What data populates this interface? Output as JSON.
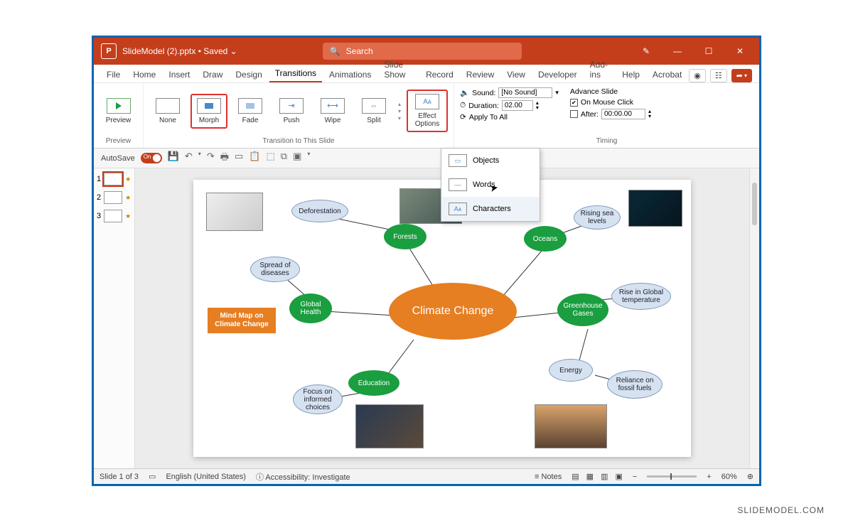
{
  "titlebar": {
    "appLetter": "P",
    "filename": "SlideModel (2).pptx",
    "savedState": "Saved",
    "searchPlaceholder": "Search"
  },
  "winControls": {
    "minimize": "—",
    "maximize": "☐",
    "close": "✕",
    "mic": "✎"
  },
  "tabs": [
    "File",
    "Home",
    "Insert",
    "Draw",
    "Design",
    "Transitions",
    "Animations",
    "Slide Show",
    "Record",
    "Review",
    "View",
    "Developer",
    "Add-ins",
    "Help",
    "Acrobat"
  ],
  "activeTab": "Transitions",
  "rightControls": {
    "record": "◉",
    "cc": "☷",
    "share": "➦"
  },
  "ribbon": {
    "previewGroupLabel": "Preview",
    "previewBtn": "Preview",
    "transitionGroupLabel": "Transition to This Slide",
    "transitions": [
      "None",
      "Morph",
      "Fade",
      "Push",
      "Wipe",
      "Split"
    ],
    "effectOptionsLabel": "Effect\nOptions",
    "timingGroupLabel": "Timing",
    "soundLabel": "Sound:",
    "soundValue": "[No Sound]",
    "durationLabel": "Duration:",
    "durationValue": "02.00",
    "applyAll": "Apply To All",
    "advanceLabel": "Advance Slide",
    "onClick": "On Mouse Click",
    "afterLabel": "After:",
    "afterValue": "00:00.00"
  },
  "qat": {
    "autosaveLabel": "AutoSave",
    "autosaveState": "On"
  },
  "thumbs": [
    "1",
    "2",
    "3"
  ],
  "dropdown": {
    "items": [
      "Objects",
      "Words",
      "Characters"
    ],
    "selected": "Characters"
  },
  "mindmap": {
    "titleBox": "Mind Map on Climate Change",
    "center": "Climate Change",
    "greenNodes": {
      "forests": "Forests",
      "oceans": "Oceans",
      "globalHealth": "Global Health",
      "greenhouse": "Greenhouse Gases",
      "education": "Education"
    },
    "blueNodes": {
      "deforestation": "Deforestation",
      "risingSea": "Rising sea levels",
      "spreadDiseases": "Spread of diseases",
      "riseTemp": "Rise in Global temperature",
      "focusChoices": "Focus on informed choices",
      "energy": "Energy",
      "relianceFossil": "Reliance on fossil fuels"
    }
  },
  "statusbar": {
    "slideInfo": "Slide 1 of 3",
    "language": "English (United States)",
    "accessibility": "Accessibility: Investigate",
    "notes": "Notes",
    "zoom": "60%"
  },
  "watermark": "SLIDEMODEL.COM"
}
